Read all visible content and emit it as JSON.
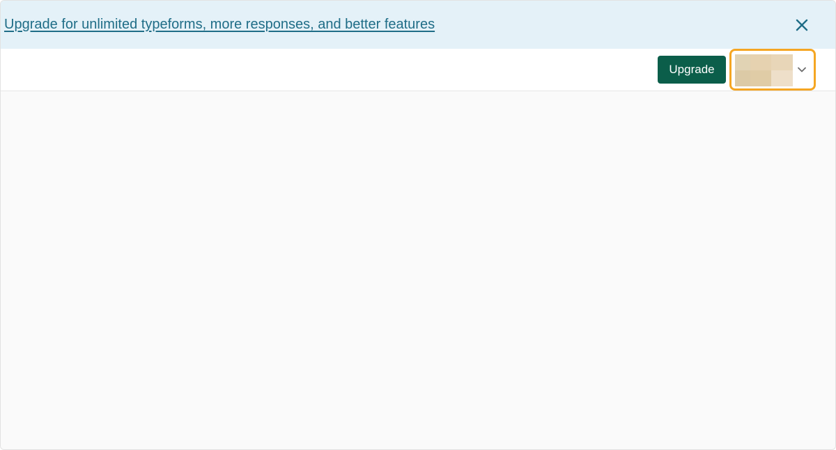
{
  "banner": {
    "link_text": "Upgrade for unlimited typeforms, more responses, and better features",
    "close_icon": "close-icon",
    "link_color": "#1f6d87",
    "background": "#e4f1f8"
  },
  "topbar": {
    "upgrade_label": "Upgrade",
    "upgrade_color": "#0b5e4a",
    "account_dropdown": {
      "avatar_icon": "avatar-blurred",
      "chevron_icon": "chevron-down-icon",
      "highlight_color": "#f5a623"
    }
  }
}
